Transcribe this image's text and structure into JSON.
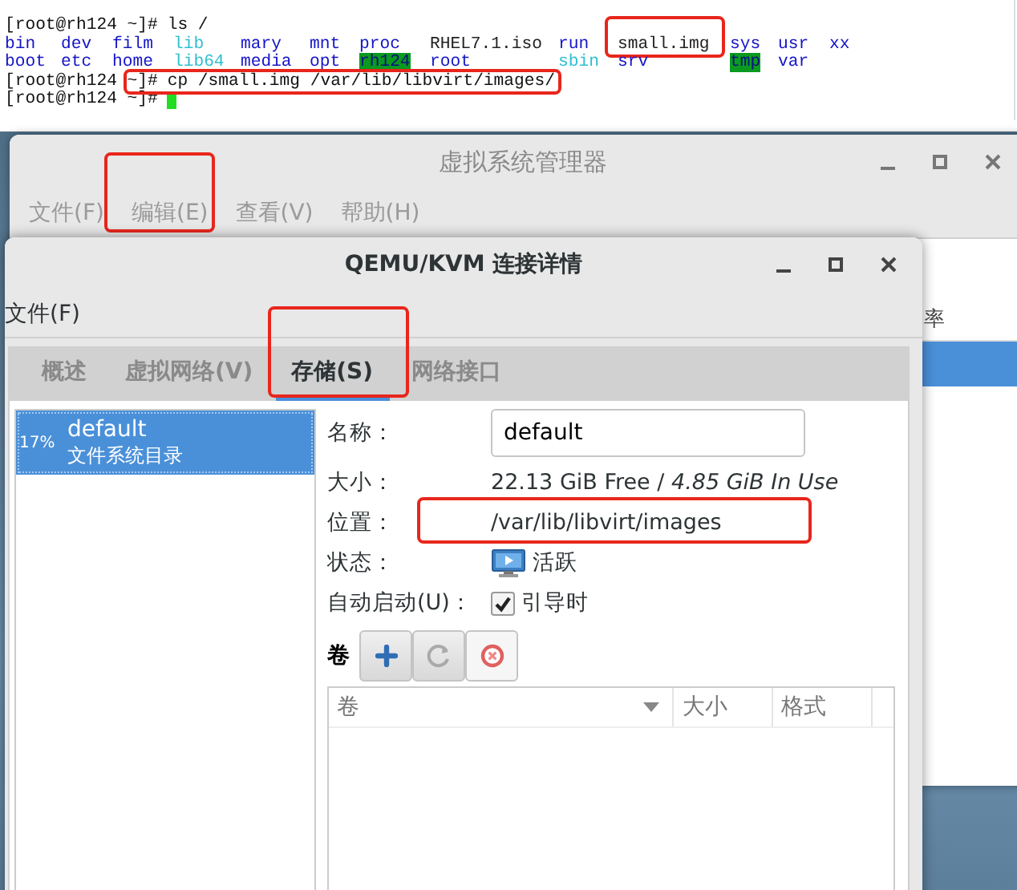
{
  "terminal": {
    "lines": [
      {
        "kind": "command",
        "prompt": "[root@rh124 ~]#",
        "command": "ls /",
        "highlighted": false
      },
      {
        "kind": "listing",
        "entries": [
          {
            "text": "bin",
            "kind": "dir",
            "highlighted": false
          },
          {
            "text": "dev",
            "kind": "dir",
            "highlighted": false
          },
          {
            "text": "film",
            "kind": "dir",
            "highlighted": false
          },
          {
            "text": "lib",
            "kind": "link",
            "highlighted": false
          },
          {
            "text": "mary",
            "kind": "dir",
            "highlighted": false
          },
          {
            "text": "mnt",
            "kind": "dir",
            "highlighted": false
          },
          {
            "text": "proc",
            "kind": "dir",
            "highlighted": false
          },
          {
            "text": "RHEL7.1.iso",
            "kind": "file",
            "highlighted": false
          },
          {
            "text": "run",
            "kind": "dir",
            "highlighted": false
          },
          {
            "text": "small.img",
            "kind": "file",
            "highlighted": true
          },
          {
            "text": "sys",
            "kind": "dir",
            "highlighted": false
          },
          {
            "text": "usr",
            "kind": "dir",
            "highlighted": false
          },
          {
            "text": "xx",
            "kind": "dir",
            "highlighted": false
          }
        ]
      },
      {
        "kind": "listing",
        "entries": [
          {
            "text": "boot",
            "kind": "dir",
            "highlighted": false
          },
          {
            "text": "etc",
            "kind": "dir",
            "highlighted": false
          },
          {
            "text": "home",
            "kind": "dir",
            "highlighted": false
          },
          {
            "text": "lib64",
            "kind": "link",
            "highlighted": false
          },
          {
            "text": "media",
            "kind": "dir",
            "highlighted": false
          },
          {
            "text": "opt",
            "kind": "dir",
            "highlighted": false
          },
          {
            "text": "rh124",
            "kind": "sticky",
            "highlighted": false
          },
          {
            "text": "root",
            "kind": "dir",
            "highlighted": false
          },
          {
            "text": "sbin",
            "kind": "link",
            "highlighted": false
          },
          {
            "text": "srv",
            "kind": "dir",
            "highlighted": false
          },
          {
            "text": "tmp",
            "kind": "sticky",
            "highlighted": false
          },
          {
            "text": "var",
            "kind": "dir",
            "highlighted": false
          }
        ]
      },
      {
        "kind": "command",
        "prompt": "[root@rh124 ~]#",
        "command": "cp /small.img /var/lib/libvirt/images/",
        "highlighted": true
      },
      {
        "kind": "cursor",
        "prompt": "[root@rh124 ~]#"
      }
    ]
  },
  "manager_window": {
    "title": "虚拟系统管理器",
    "menu": [
      {
        "label": "文件(F)",
        "highlighted": false
      },
      {
        "label": "编辑(E)",
        "highlighted": true
      },
      {
        "label": "查看(V)",
        "highlighted": false
      },
      {
        "label": "帮助(H)",
        "highlighted": false
      }
    ],
    "list": {
      "column": "率",
      "rows": [
        {
          "selected": true
        }
      ]
    }
  },
  "details_window": {
    "title": "QEMU/KVM 连接详情",
    "menu": [
      {
        "label": "文件(F)"
      }
    ],
    "tabs": [
      {
        "label": "概述",
        "selected": false,
        "highlighted": false
      },
      {
        "label": "虚拟网络(V)",
        "selected": false,
        "highlighted": false
      },
      {
        "label": "存储(S)",
        "selected": true,
        "highlighted": true
      },
      {
        "label": "网络接口",
        "selected": false,
        "highlighted": false
      }
    ],
    "pools": [
      {
        "usage": "17%",
        "name": "default",
        "type": "文件系统目录",
        "selected": true
      }
    ],
    "fields": [
      {
        "kind": "input",
        "label": "名称：",
        "value": "default",
        "highlighted": false
      },
      {
        "kind": "text",
        "label": "大小：",
        "value": "22.13 GiB Free / *4.85 GiB In Use*",
        "highlighted": false
      },
      {
        "kind": "text",
        "label": "位置：",
        "value": "/var/lib/libvirt/images",
        "highlighted": true
      },
      {
        "kind": "status",
        "label": "状态：",
        "value": "活跃",
        "active": true
      },
      {
        "kind": "checkbox",
        "label": "自动启动(U)：",
        "value": "引导时",
        "checked": true
      }
    ],
    "volumes": {
      "label": "卷",
      "buttons": [
        {
          "kind": "add"
        },
        {
          "kind": "refresh"
        },
        {
          "kind": "delete"
        }
      ],
      "columns": [
        {
          "label": "卷",
          "sorted": true
        },
        {
          "label": "大小",
          "sorted": false
        },
        {
          "label": "格式",
          "sorted": false
        }
      ]
    }
  }
}
